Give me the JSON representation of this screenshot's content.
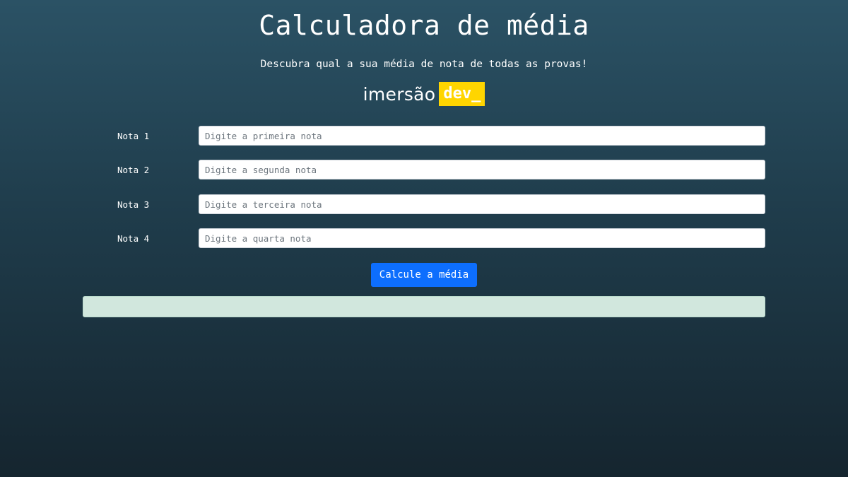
{
  "header": {
    "title": "Calculadora de média",
    "subtitle": "Descubra qual a sua média de nota de todas as provas!"
  },
  "logo": {
    "word": "imersão",
    "badge": "dev_",
    "badge_color": "#ffd500"
  },
  "form": {
    "fields": [
      {
        "label": "Nota 1",
        "placeholder": "Digite a primeira nota",
        "value": ""
      },
      {
        "label": "Nota 2",
        "placeholder": "Digite a segunda nota",
        "value": ""
      },
      {
        "label": "Nota 3",
        "placeholder": "Digite a terceira nota",
        "value": ""
      },
      {
        "label": "Nota 4",
        "placeholder": "Digite a quarta nota",
        "value": ""
      }
    ],
    "submit_label": "Calcule a média",
    "submit_color": "#0d6efd"
  },
  "result": {
    "text": "",
    "background_color": "#d1e7dd"
  }
}
